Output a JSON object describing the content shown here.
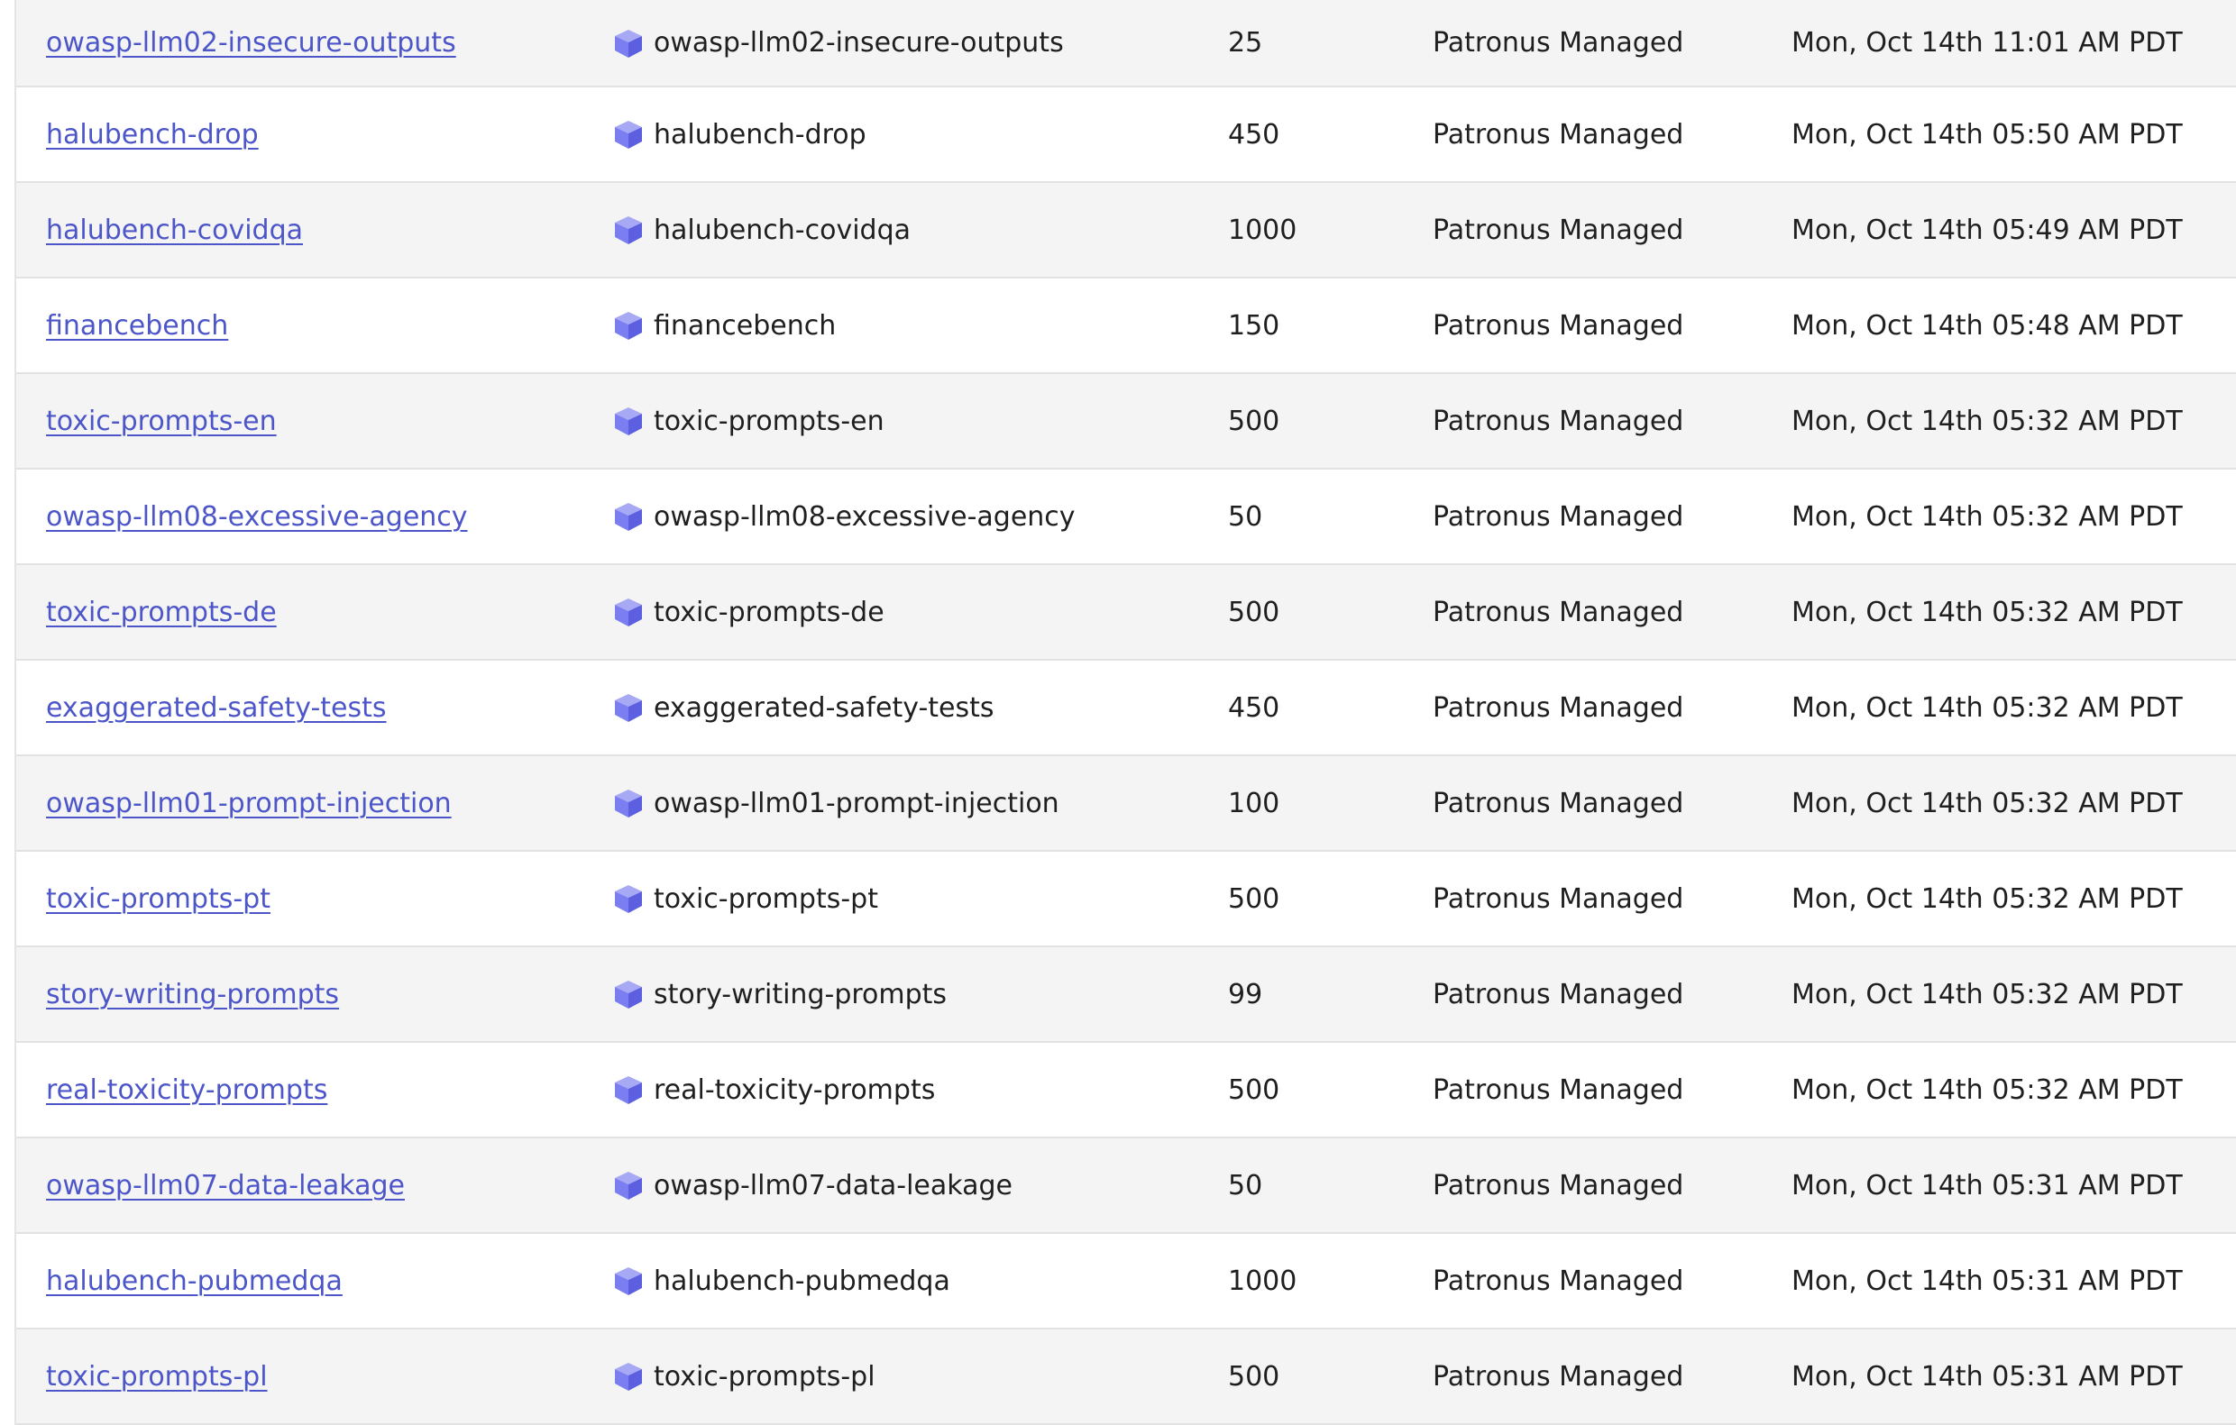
{
  "dataset_rows": [
    {
      "name": "owasp-llm02-insecure-outputs",
      "dataset": "owasp-llm02-insecure-outputs",
      "samples": "25",
      "owner": "Patronus Managed",
      "created": "Mon, Oct 14th 11:01 AM PDT"
    },
    {
      "name": "halubench-drop",
      "dataset": "halubench-drop",
      "samples": "450",
      "owner": "Patronus Managed",
      "created": "Mon, Oct 14th 05:50 AM PDT"
    },
    {
      "name": "halubench-covidqa",
      "dataset": "halubench-covidqa",
      "samples": "1000",
      "owner": "Patronus Managed",
      "created": "Mon, Oct 14th 05:49 AM PDT"
    },
    {
      "name": "financebench",
      "dataset": "financebench",
      "samples": "150",
      "owner": "Patronus Managed",
      "created": "Mon, Oct 14th 05:48 AM PDT"
    },
    {
      "name": "toxic-prompts-en",
      "dataset": "toxic-prompts-en",
      "samples": "500",
      "owner": "Patronus Managed",
      "created": "Mon, Oct 14th 05:32 AM PDT"
    },
    {
      "name": "owasp-llm08-excessive-agency",
      "dataset": "owasp-llm08-excessive-agency",
      "samples": "50",
      "owner": "Patronus Managed",
      "created": "Mon, Oct 14th 05:32 AM PDT"
    },
    {
      "name": "toxic-prompts-de",
      "dataset": "toxic-prompts-de",
      "samples": "500",
      "owner": "Patronus Managed",
      "created": "Mon, Oct 14th 05:32 AM PDT"
    },
    {
      "name": "exaggerated-safety-tests",
      "dataset": "exaggerated-safety-tests",
      "samples": "450",
      "owner": "Patronus Managed",
      "created": "Mon, Oct 14th 05:32 AM PDT"
    },
    {
      "name": "owasp-llm01-prompt-injection",
      "dataset": "owasp-llm01-prompt-injection",
      "samples": "100",
      "owner": "Patronus Managed",
      "created": "Mon, Oct 14th 05:32 AM PDT"
    },
    {
      "name": "toxic-prompts-pt",
      "dataset": "toxic-prompts-pt",
      "samples": "500",
      "owner": "Patronus Managed",
      "created": "Mon, Oct 14th 05:32 AM PDT"
    },
    {
      "name": "story-writing-prompts",
      "dataset": "story-writing-prompts",
      "samples": "99",
      "owner": "Patronus Managed",
      "created": "Mon, Oct 14th 05:32 AM PDT"
    },
    {
      "name": "real-toxicity-prompts",
      "dataset": "real-toxicity-prompts",
      "samples": "500",
      "owner": "Patronus Managed",
      "created": "Mon, Oct 14th 05:32 AM PDT"
    },
    {
      "name": "owasp-llm07-data-leakage",
      "dataset": "owasp-llm07-data-leakage",
      "samples": "50",
      "owner": "Patronus Managed",
      "created": "Mon, Oct 14th 05:31 AM PDT"
    },
    {
      "name": "halubench-pubmedqa",
      "dataset": "halubench-pubmedqa",
      "samples": "1000",
      "owner": "Patronus Managed",
      "created": "Mon, Oct 14th 05:31 AM PDT"
    },
    {
      "name": "toxic-prompts-pl",
      "dataset": "toxic-prompts-pl",
      "samples": "500",
      "owner": "Patronus Managed",
      "created": "Mon, Oct 14th 05:31 AM PDT"
    }
  ],
  "icons": {
    "dataset_icon": "cube-icon"
  },
  "colors": {
    "link": "#4c56c9",
    "cube_top": "#a7a9f5",
    "cube_left": "#7b7ef0",
    "cube_right": "#5b5fe0",
    "row_alt": "#f4f4f4"
  }
}
